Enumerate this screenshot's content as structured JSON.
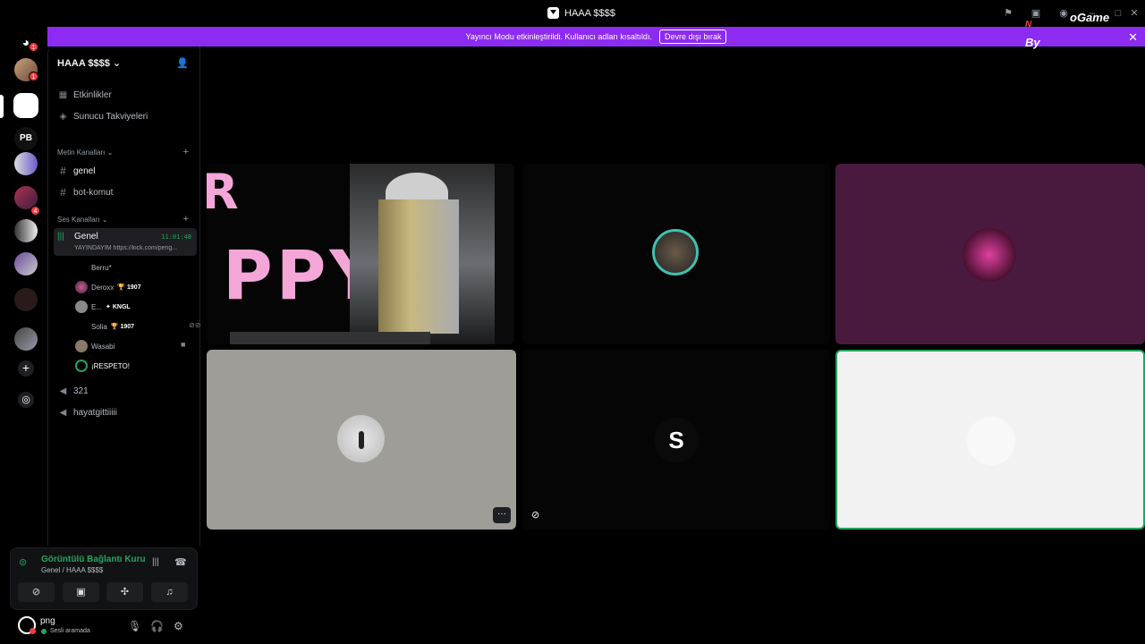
{
  "titlebar": {
    "title": "HAAA $$$$",
    "watermark_top": "oGame",
    "watermark_n": "N",
    "watermark_by": "By"
  },
  "banner": {
    "message": "Yayıncı Modu etkinleştirildi. Kullanıcı adları kısaltıldı.",
    "button": "Devre dışı bırak"
  },
  "server": {
    "name": "HAAA $$$$",
    "items": [
      {
        "label": "Etkinlikler",
        "icon": "calendar-icon"
      },
      {
        "label": "Sunucu Takviyeleri",
        "icon": "boost-icon"
      }
    ]
  },
  "text_category": {
    "label": "Metin Kanalları",
    "channels": [
      "genel",
      "bot-komut"
    ]
  },
  "voice_category": {
    "label": "Ses Kanalları",
    "active_channel": {
      "name": "Genel",
      "time": "11:01:48",
      "status": "YAYINDAYIM https://kick.com/peng..."
    },
    "users": [
      {
        "name": "Berru*",
        "tag": ""
      },
      {
        "name": "Deroxx",
        "tag": "1907"
      },
      {
        "name": "E...",
        "tag": "KNGL"
      },
      {
        "name": "Solia",
        "tag": "1907"
      },
      {
        "name": "Wasabi",
        "tag": ""
      },
      {
        "name": "¡RESPETO!",
        "tag": ""
      }
    ],
    "other_channels": [
      "321",
      "hayatgittiiiii"
    ]
  },
  "voice_panel": {
    "status": "Görüntülü Bağlantı Kuru",
    "location": "Genel / HAAA $$$$"
  },
  "user_panel": {
    "name": "png",
    "status": "Sesli aramada"
  },
  "stage": {
    "tile_labels": {
      "s_avatar": "S"
    },
    "stream_text": "PPY"
  },
  "colors": {
    "accent": "#8c2cf0",
    "online": "#23a55a",
    "tile_purple": "#4a1a3e",
    "tile_grey": "#9e9d98"
  }
}
